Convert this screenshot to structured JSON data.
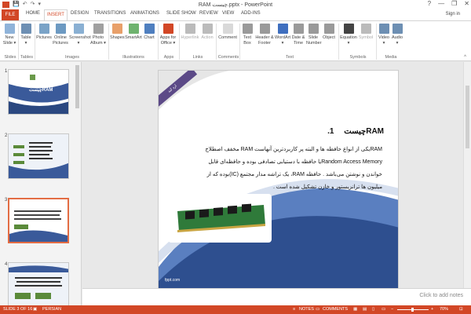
{
  "titlebar": {
    "title": "RAM چیست.pptx - PowerPoint",
    "qat": [
      "💾",
      "↶",
      "↷",
      "▾"
    ],
    "help": "?",
    "minimize": "—",
    "restore": "❐",
    "close": "✕"
  },
  "tabs": [
    "FILE",
    "HOME",
    "INSERT",
    "DESIGN",
    "TRANSITIONS",
    "ANIMATIONS",
    "SLIDE SHOW",
    "REVIEW",
    "VIEW",
    "ADD-INS"
  ],
  "active_tab": "INSERT",
  "sign_in": "Sign in",
  "ribbon": {
    "groups": [
      "Slides",
      "Tables",
      "Images",
      "Illustrations",
      "Apps",
      "Links",
      "Comments",
      "Text",
      "Symbols",
      "Media"
    ],
    "buttons": [
      {
        "label": "New Slide ▾",
        "icon": "new-slide-icon",
        "color": "#8fb3d9"
      },
      {
        "label": "Table ▾",
        "icon": "table-icon",
        "color": "#6d8fb3"
      },
      {
        "label": "Pictures",
        "icon": "pictures-icon",
        "color": "#7aa3c7"
      },
      {
        "label": "Online Pictures",
        "icon": "online-pictures-icon",
        "color": "#6d9ac2"
      },
      {
        "label": "Screenshot ▾",
        "icon": "screenshot-icon",
        "color": "#8ab0d3"
      },
      {
        "label": "Photo Album ▾",
        "icon": "photo-album-icon",
        "color": "#a0a0a0"
      },
      {
        "label": "Shapes",
        "icon": "shapes-icon",
        "color": "#e8a06a"
      },
      {
        "label": "SmartArt",
        "icon": "smartart-icon",
        "color": "#6fb36f"
      },
      {
        "label": "Chart",
        "icon": "chart-icon",
        "color": "#4f7fbf"
      },
      {
        "label": "Apps for Office ▾",
        "icon": "apps-icon",
        "color": "#d24726"
      },
      {
        "label": "Hyperlink",
        "icon": "hyperlink-icon",
        "color": "#bbbbbb"
      },
      {
        "label": "Action",
        "icon": "action-icon",
        "color": "#bbbbbb"
      },
      {
        "label": "Comment",
        "icon": "comment-icon",
        "color": "#d9d9d9"
      },
      {
        "label": "Text Box",
        "icon": "text-box-icon",
        "color": "#9a9a9a"
      },
      {
        "label": "Header & Footer",
        "icon": "header-footer-icon",
        "color": "#9a9a9a"
      },
      {
        "label": "WordArt ▾",
        "icon": "wordart-icon",
        "color": "#3f6fbf"
      },
      {
        "label": "Date & Time",
        "icon": "date-time-icon",
        "color": "#9a9a9a"
      },
      {
        "label": "Slide Number",
        "icon": "slide-number-icon",
        "color": "#9a9a9a"
      },
      {
        "label": "Object",
        "icon": "object-icon",
        "color": "#9a9a9a"
      },
      {
        "label": "Equation ▾",
        "icon": "equation-icon",
        "color": "#444444"
      },
      {
        "label": "Symbol",
        "icon": "symbol-icon",
        "color": "#bbbbbb"
      },
      {
        "label": "Video ▾",
        "icon": "video-icon",
        "color": "#6d8fb3"
      },
      {
        "label": "Audio ▾",
        "icon": "audio-icon",
        "color": "#6d8fb3"
      }
    ]
  },
  "thumbnails": [
    {
      "number": "1",
      "title": "RAMچیست"
    },
    {
      "number": "2",
      "title": ""
    },
    {
      "number": "3",
      "title": ""
    },
    {
      "number": "4",
      "title": ""
    }
  ],
  "slide": {
    "badge": "ارد لند",
    "heading_number": "1.",
    "heading": "RAMچیست",
    "body": [
      "RAMیکی از انواع حافظه ها و البته پر کاربردترین آنهاست RAM مخفف اصطلاح",
      "Random Access Memoryیا حافظه با دستیابی تصادفی بوده و حافظه‌ای قابل",
      "خواندن و نوشتن می‌باشد . حافظه RAM، یک تراشه مدار مجتمع (IC)بوده که از",
      "میلیون ها ترانزیستور و خازن تشکیل شده است ."
    ],
    "footer_url": "fppt.com"
  },
  "notes_placeholder": "Click to add notes",
  "status": {
    "slide": "SLIDE 3 OF 16",
    "language": "PERSIAN",
    "notes": "NOTES",
    "comments": "COMMENTS",
    "zoom": "70%"
  },
  "colors": {
    "accent": "#d24726",
    "badge": "#5c4a87",
    "slide_blue": "#3a5a9a"
  }
}
